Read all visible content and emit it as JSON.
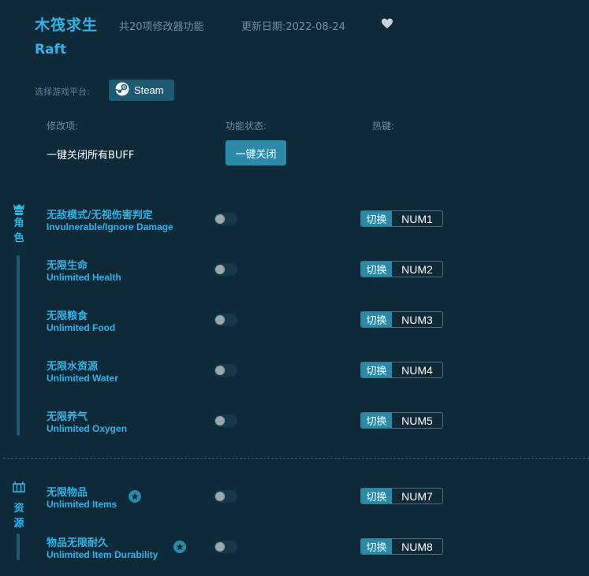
{
  "header": {
    "title_cn": "木筏求生",
    "feature_count": "共20项修改器功能",
    "update_date": "更新日期:2022-08-24",
    "title_en": "Raft"
  },
  "platform": {
    "label": "选择游戏平台:",
    "steam_label": "Steam"
  },
  "columns": {
    "mod": "修改项:",
    "state": "功能状态:",
    "hotkey": "热键:"
  },
  "buff": {
    "label": "一键关闭所有BUFF",
    "button": "一键关闭"
  },
  "categories": [
    {
      "chars": [
        "角",
        "色"
      ],
      "icon": "character-icon"
    },
    {
      "chars": [
        "资",
        "源"
      ],
      "icon": "resource-icon"
    }
  ],
  "switch_label": "切换",
  "rows": [
    {
      "cn": "无敌模式/无视伤害判定",
      "en": "Invulnerable/Ignore Damage",
      "key": "NUM1",
      "enabled": false
    },
    {
      "cn": "无限生命",
      "en": "Unlimited Health",
      "key": "NUM2",
      "enabled": false
    },
    {
      "cn": "无限粮食",
      "en": "Unlimited Food",
      "key": "NUM3",
      "enabled": false
    },
    {
      "cn": "无限水资源",
      "en": "Unlimited Water",
      "key": "NUM4",
      "enabled": false
    },
    {
      "cn": "无限养气",
      "en": "Unlimited Oxygen",
      "key": "NUM5",
      "enabled": false
    },
    {
      "cn": "无限物品",
      "en": "Unlimited Items",
      "key": "NUM7",
      "enabled": false,
      "starred": true
    },
    {
      "cn": "物品无限耐久",
      "en": "Unlimited Item Durability",
      "key": "NUM8",
      "enabled": false,
      "starred": true
    }
  ],
  "colors": {
    "background": "#0e2a38",
    "accent": "#2fb2e6",
    "button": "#2a8aa8"
  }
}
